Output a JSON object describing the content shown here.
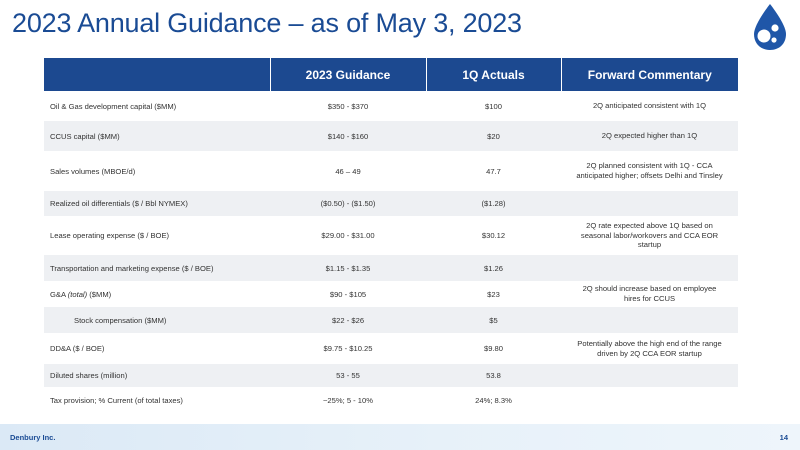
{
  "header": {
    "title": "2023 Annual Guidance – as of May 3, 2023"
  },
  "colors": {
    "brand_blue": "#1c4990",
    "title_blue": "#1a4b94",
    "row_alt": "#eef0f3"
  },
  "table": {
    "columns": [
      "",
      "2023 Guidance",
      "1Q Actuals",
      "Forward Commentary"
    ],
    "rows": [
      {
        "label": "Oil & Gas development capital ($MM)",
        "guidance": "$350 - $370",
        "actual": "$100",
        "commentary": "2Q anticipated consistent with 1Q"
      },
      {
        "label": "CCUS capital ($MM)",
        "guidance": "$140 - $160",
        "actual": "$20",
        "commentary": "2Q expected higher than 1Q"
      },
      {
        "label": "Sales volumes (MBOE/d)",
        "guidance": "46 – 49",
        "actual": "47.7",
        "commentary": "2Q planned consistent with 1Q - CCA anticipated higher; offsets Delhi and Tinsley"
      },
      {
        "label": "Realized oil differentials ($ / Bbl NYMEX)",
        "guidance": "($0.50) - ($1.50)",
        "actual": "($1.28)",
        "commentary": ""
      },
      {
        "label": "Lease operating expense ($ / BOE)",
        "guidance": "$29.00 - $31.00",
        "actual": "$30.12",
        "commentary": "2Q rate expected above 1Q based on seasonal labor/workovers and CCA EOR startup"
      },
      {
        "label": "Transportation and marketing expense ($ / BOE)",
        "guidance": "$1.15 - $1.35",
        "actual": "$1.26",
        "commentary": ""
      },
      {
        "label_prefix": "G&A ",
        "label_italic": "(total)",
        "label_suffix": " ($MM)",
        "guidance": "$90 - $105",
        "actual": "$23",
        "commentary": "2Q should increase based on employee hires for CCUS"
      },
      {
        "label": "Stock compensation ($MM)",
        "guidance": "$22 - $26",
        "actual": "$5",
        "commentary": ""
      },
      {
        "label": "DD&A ($ / BOE)",
        "guidance": "$9.75 - $10.25",
        "actual": "$9.80",
        "commentary": "Potentially above the high end of the range driven by 2Q CCA EOR startup"
      },
      {
        "label": "Diluted shares (million)",
        "guidance": "53 - 55",
        "actual": "53.8",
        "commentary": ""
      },
      {
        "label": "Tax provision; % Current (of total taxes)",
        "guidance": "~25%; 5 - 10%",
        "actual": "24%; 8.3%",
        "commentary": ""
      }
    ]
  },
  "footer": {
    "company": "Denbury Inc.",
    "page": "14"
  },
  "logo": {
    "icon": "denbury-drop-logo-icon"
  }
}
